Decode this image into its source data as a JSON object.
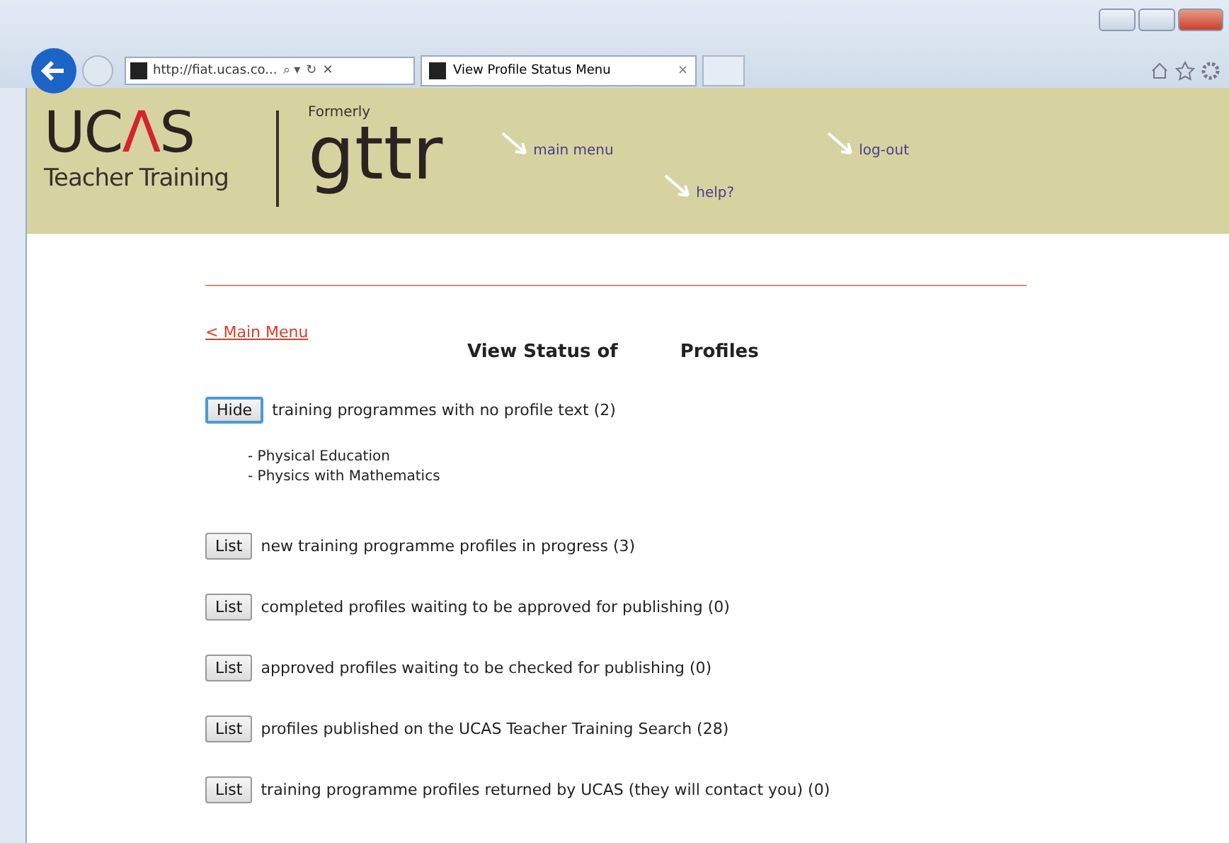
{
  "browser": {
    "address": "http://fiat.ucas.co...",
    "address_icons": [
      "⌕ ▾",
      "↻",
      "✕"
    ],
    "tab_title": "View Profile Status Menu",
    "tab_close": "×"
  },
  "header": {
    "logo_prefix": "UC",
    "logo_mark": "Λ",
    "logo_suffix": "S",
    "logo_subtitle": "Teacher Training",
    "formerly": "Formerly",
    "brand": "gttr",
    "links": [
      {
        "label": "main menu"
      },
      {
        "label": "help?"
      },
      {
        "label": "log-out"
      }
    ]
  },
  "back_link": "< Main Menu",
  "title": {
    "left": "View Status of",
    "right": "Profiles"
  },
  "sections": [
    {
      "button": "Hide",
      "focused": true,
      "text": "training programmes with no profile text (2)",
      "items": [
        "- Physical Education",
        "- Physics with Mathematics"
      ]
    },
    {
      "button": "List",
      "focused": false,
      "text": "new training programme profiles in progress (3)"
    },
    {
      "button": "List",
      "focused": false,
      "text": "completed profiles waiting to be approved for publishing (0)"
    },
    {
      "button": "List",
      "focused": false,
      "text": "approved profiles waiting to be checked for publishing (0)"
    },
    {
      "button": "List",
      "focused": false,
      "text": "profiles published on the UCAS Teacher Training Search (28)"
    },
    {
      "button": "List",
      "focused": false,
      "text": "training programme profiles returned by UCAS (they will contact you) (0)"
    }
  ]
}
